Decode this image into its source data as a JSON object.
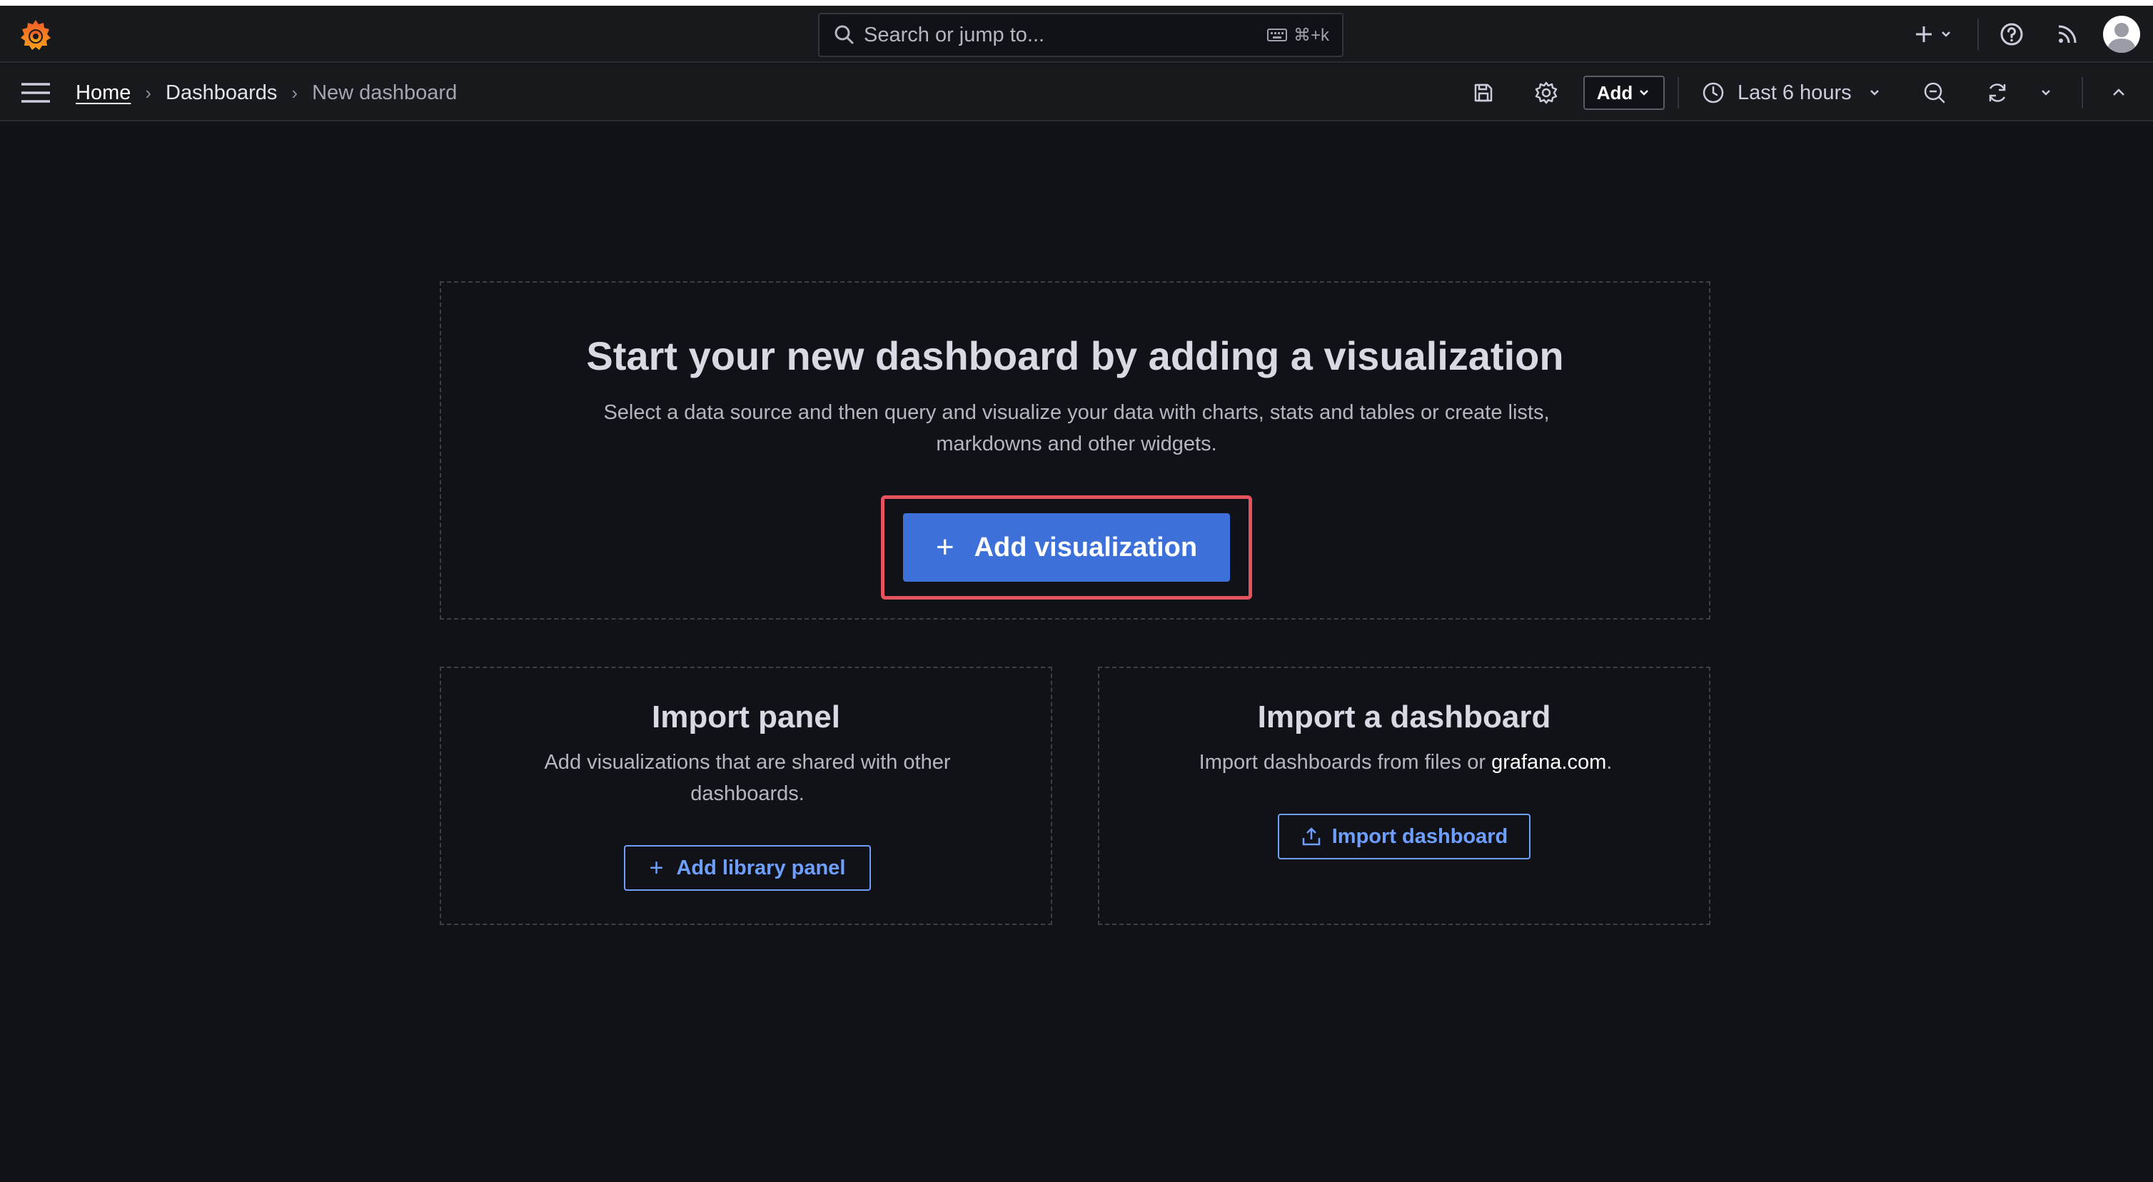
{
  "topbar": {
    "search_placeholder": "Search or jump to...",
    "search_shortcut": "⌘+k"
  },
  "breadcrumb": {
    "home": "Home",
    "dashboards": "Dashboards",
    "current": "New dashboard"
  },
  "toolbar": {
    "add_label": "Add",
    "time_range": "Last 6 hours"
  },
  "hero": {
    "title": "Start your new dashboard by adding a visualization",
    "description": "Select a data source and then query and visualize your data with charts, stats and tables or create lists, markdowns and other widgets.",
    "button_label": "Add visualization"
  },
  "import_panel": {
    "title": "Import panel",
    "description": "Add visualizations that are shared with other dashboards.",
    "button_label": "Add library panel"
  },
  "import_dashboard": {
    "title": "Import a dashboard",
    "description_prefix": "Import dashboards from files or ",
    "link_text": "grafana.com",
    "description_suffix": ".",
    "button_label": "Import dashboard"
  },
  "colors": {
    "background": "#111217",
    "bar": "#18191d",
    "primary": "#3d71d9",
    "link": "#6e9fff",
    "highlight": "#e5535f"
  }
}
